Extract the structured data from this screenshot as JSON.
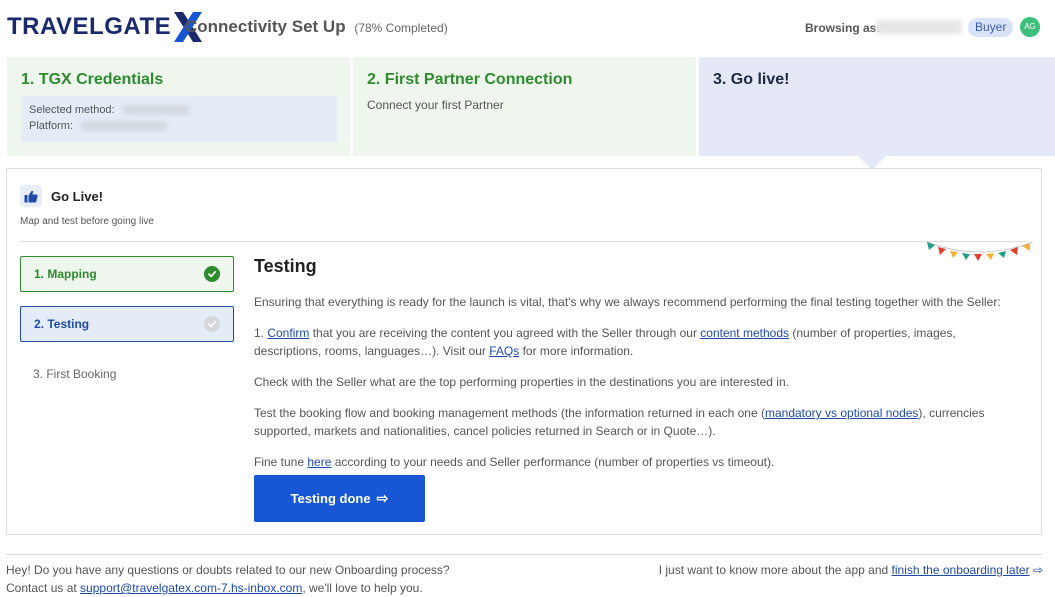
{
  "header": {
    "logo_text": "TRAVELGATE",
    "title": "Connectivity Set Up",
    "progress": "(78% Completed)",
    "browsing_label": "Browsing as:",
    "role": "Buyer",
    "avatar_initials": "AG"
  },
  "steps": [
    {
      "label": "1. TGX Credentials",
      "details": {
        "method_label": "Selected method:",
        "platform_label": "Platform:"
      }
    },
    {
      "label": "2. First Partner Connection",
      "subtitle": "Connect your first Partner"
    },
    {
      "label": "3. Go live!"
    }
  ],
  "card": {
    "title": "Go Live!",
    "subtitle": "Map and test before going live"
  },
  "sub_steps": [
    {
      "label": "1. Mapping",
      "status": "done"
    },
    {
      "label": "2. Testing",
      "status": "active"
    },
    {
      "label": "3. First Booking",
      "status": "pending"
    }
  ],
  "content": {
    "title": "Testing",
    "intro": "Ensuring that everything is ready for the launch is vital, that's why we always recommend performing the final testing together with the Seller:",
    "p1_prefix": "1. ",
    "p1_link1": "Confirm",
    "p1_mid": " that you are receiving the content you agreed with the Seller through our ",
    "p1_link2": "content methods",
    "p1_mid2": " (number of properties, images, descriptions, rooms, languages…). Visit our ",
    "p1_link3": "FAQs",
    "p1_suffix": " for more information.",
    "p2": "Check with the Seller what are the top performing properties in the destinations you are interested in.",
    "p3_prefix": "Test the booking flow and booking management methods (the information returned in each one (",
    "p3_link": "mandatory vs optional nodes",
    "p3_suffix": "), currencies supported, markets and nationalities, cancel policies returned in Search or in Quote…).",
    "p4_prefix": "Fine tune ",
    "p4_link": "here",
    "p4_suffix": " according to your needs and Seller performance (number of properties vs timeout).",
    "button_label": "Testing done",
    "button_arrow": "⇨"
  },
  "footer": {
    "line1": "Hey! Do you have any questions or doubts related to our new Onboarding process?",
    "line2_prefix": "Contact us at ",
    "email": "support@travelgatex.com-7.hs-inbox.com",
    "line2_suffix": ", we'll love to help you.",
    "right_prefix": "I just want to know more about the app and ",
    "right_link": "finish the onboarding later",
    "right_arrow": "⇨"
  },
  "colors": {
    "brand_navy": "#1a2a6c",
    "brand_blue": "#1757d6",
    "success_green": "#2e8b2e",
    "step_done_bg": "#eef6ee",
    "step_current_bg": "#e4e8f7"
  }
}
